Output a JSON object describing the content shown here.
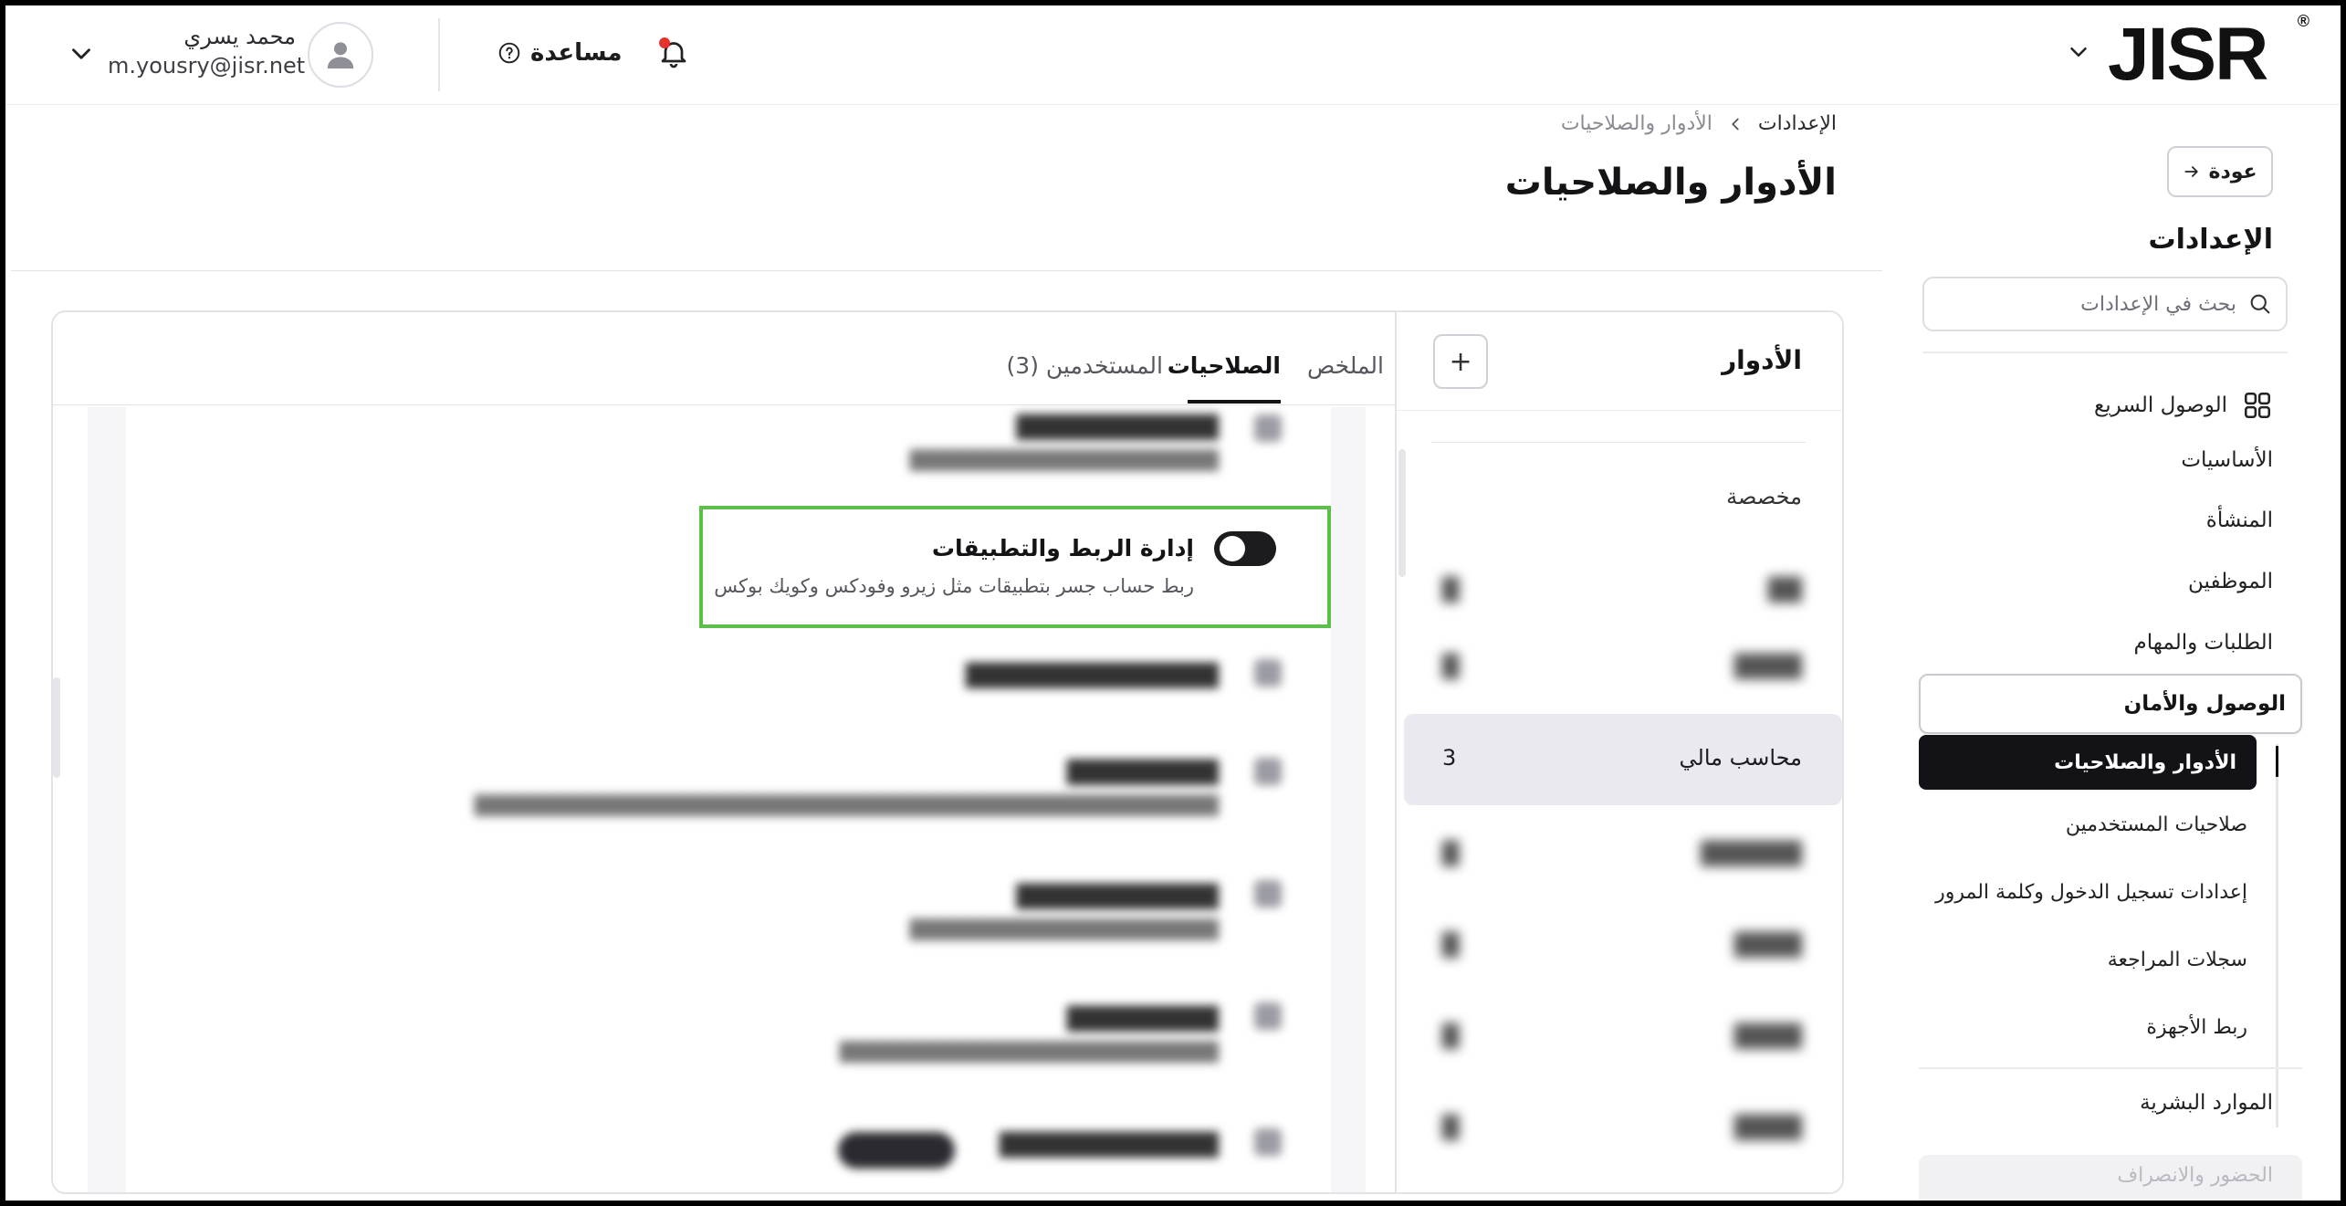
{
  "topbar": {
    "logo": "JISR",
    "logo_reg": "®",
    "user_name": "محمد يسري",
    "user_email": "m.yousry@jisr.net",
    "help_label": "مساعدة"
  },
  "sidebar": {
    "back_label": "عودة",
    "title": "الإعدادات",
    "search_placeholder": "بحث في الإعدادات",
    "quick_access": "الوصول السريع",
    "items": {
      "basics": "الأساسيات",
      "organization": "المنشأة",
      "employees": "الموظفين",
      "requests": "الطلبات والمهام",
      "security": "الوصول والأمان",
      "hr": "الموارد البشرية",
      "attendance": "الحضور والانصراف"
    },
    "security_sub": {
      "roles": "الأدوار والصلاحيات",
      "user_permissions": "صلاحيات المستخدمين",
      "login_settings": "إعدادات تسجيل الدخول وكلمة المرور",
      "audit_logs": "سجلات المراجعة",
      "devices": "ربط الأجهزة"
    }
  },
  "header": {
    "breadcrumb_root": "الإعدادات",
    "breadcrumb_current": "الأدوار والصلاحيات",
    "page_title": "الأدوار والصلاحيات"
  },
  "roles": {
    "title": "الأدوار",
    "add_label": "+",
    "group_label": "مخصصة",
    "selected_role": {
      "name": "محاسب مالي",
      "count": "3"
    }
  },
  "tabs": {
    "summary": "الملخص",
    "permissions": "الصلاحيات",
    "users": "المستخدمين (3)"
  },
  "permission_highlight": {
    "title": "إدارة الربط والتطبيقات",
    "description": "ربط حساب جسر بتطبيقات مثل زيرو وفودكس وكويك بوكس",
    "enabled": false
  },
  "colors": {
    "highlight_border": "#5bbf4a",
    "active_dark": "#131317",
    "notification": "#e5322d"
  }
}
